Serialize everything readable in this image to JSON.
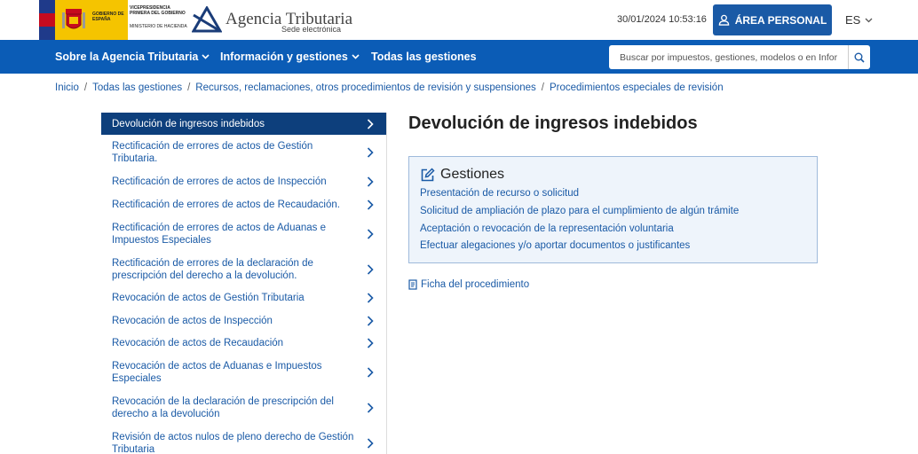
{
  "header": {
    "gov_text_1": "GOBIERNO DE ESPAÑA",
    "gov_text_2": "VICEPRESIDENCIA PRIMERA DEL GOBIERNO",
    "gov_text_3": "MINISTERIO DE HACIENDA",
    "agency_title": "Agencia Tributaria",
    "agency_subtitle": "Sede electrónica",
    "datetime": "30/01/2024 10:53:16",
    "area_personal_label": "ÁREA PERSONAL",
    "language": "ES",
    "brand_color": "#0b5cb6"
  },
  "nav": {
    "items": [
      {
        "label": "Sobre la Agencia Tributaria",
        "dropdown": true
      },
      {
        "label": "Información y gestiones",
        "dropdown": true
      },
      {
        "label": "Todas las gestiones",
        "dropdown": false
      }
    ],
    "search_placeholder": "Buscar por impuestos, gestiones, modelos o en Infor…"
  },
  "breadcrumb": [
    "Inicio",
    "Todas las gestiones",
    "Recursos, reclamaciones, otros procedimientos de revisión y suspensiones",
    "Procedimientos especiales de revisión"
  ],
  "sidebar": {
    "items": [
      {
        "label": "Devolución de ingresos indebidos",
        "active": true
      },
      {
        "label": "Rectificación de errores de actos de Gestión Tributaria."
      },
      {
        "label": "Rectificación de errores de actos de Inspección"
      },
      {
        "label": "Rectificación de errores de actos de Recaudación."
      },
      {
        "label": "Rectificación de errores de actos de Aduanas e Impuestos Especiales"
      },
      {
        "label": "Rectificación de errores de la declaración de prescripción del derecho a la devolución."
      },
      {
        "label": "Revocación de actos de Gestión Tributaria"
      },
      {
        "label": "Revocación de actos de Inspección"
      },
      {
        "label": "Revocación de actos de Recaudación"
      },
      {
        "label": "Revocación de actos de Aduanas e Impuestos Especiales"
      },
      {
        "label": "Revocación de la declaración de prescripción del derecho a la devolución"
      },
      {
        "label": "Revisión de actos nulos de pleno derecho de Gestión Tributaria"
      }
    ]
  },
  "main": {
    "title": "Devolución de ingresos indebidos",
    "gestiones_heading": "Gestiones",
    "gestiones_links": [
      "Presentación de recurso o solicitud",
      "Solicitud de ampliación de plazo para el cumplimiento de algún trámite",
      "Aceptación o revocación de la representación voluntaria",
      "Efectuar alegaciones y/o aportar documentos o justificantes"
    ],
    "ficha_label": "Ficha del procedimiento"
  }
}
